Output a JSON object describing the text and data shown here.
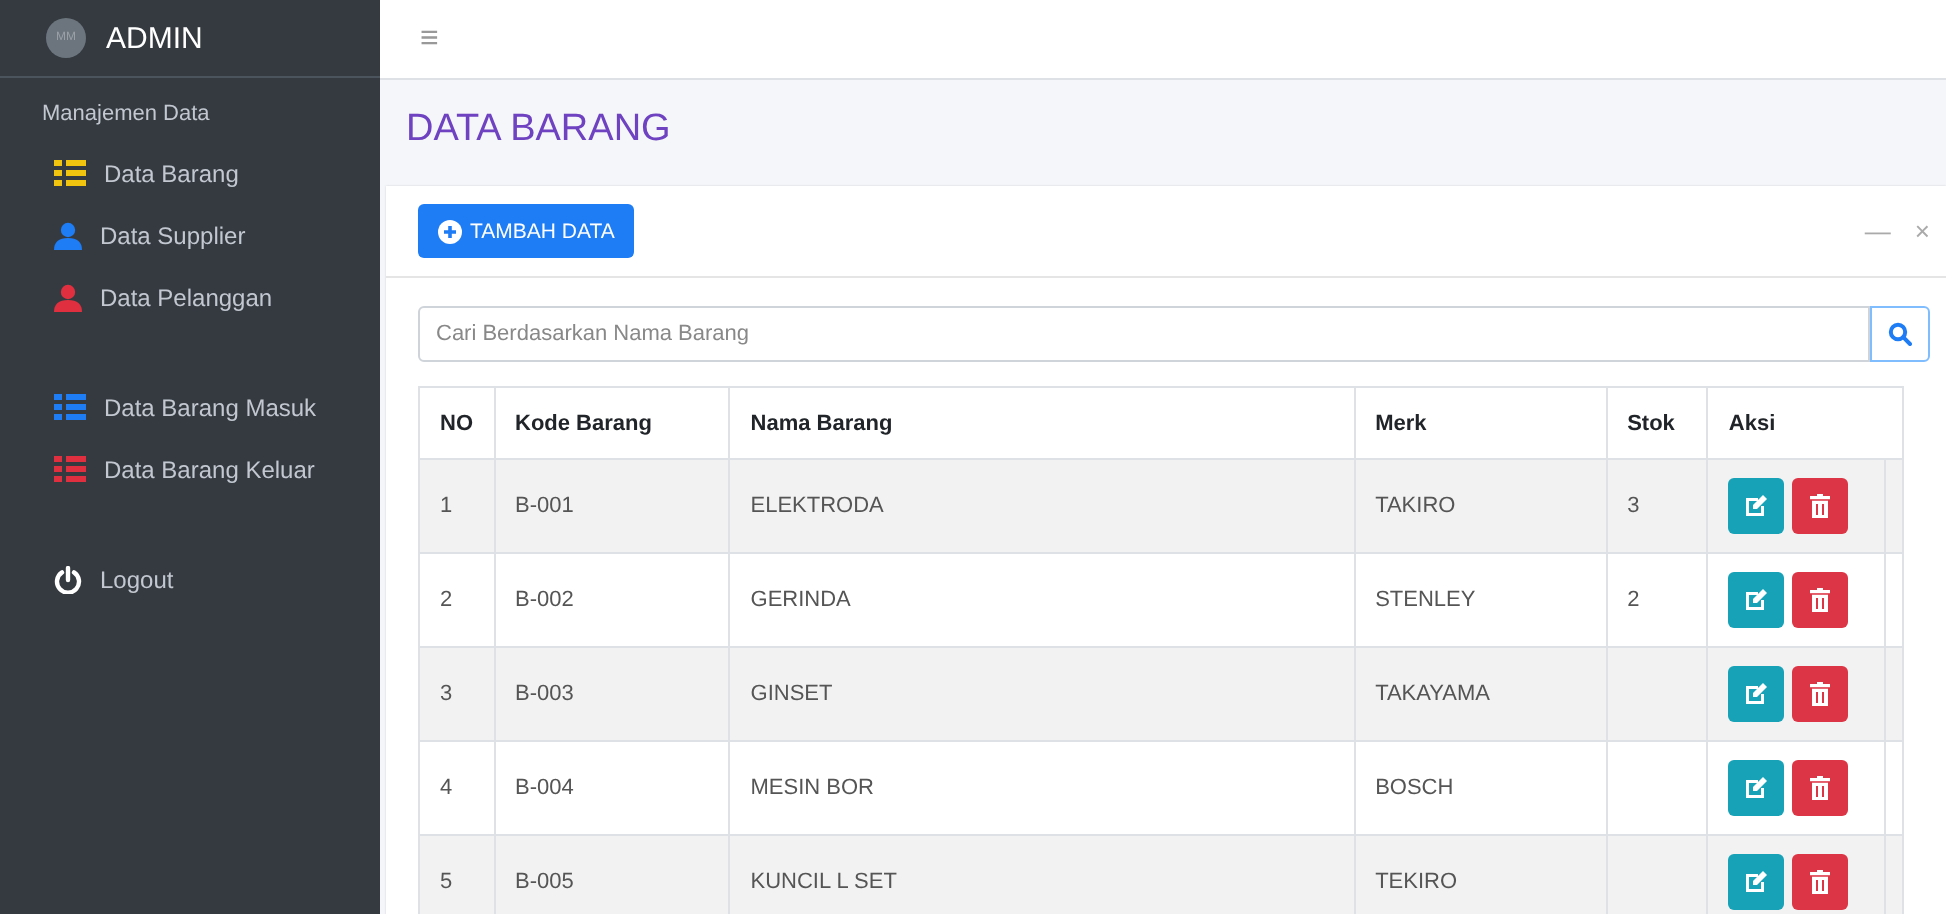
{
  "brand": {
    "avatar": "MM",
    "title": "ADMIN"
  },
  "sidebar": {
    "heading": "Manajemen Data",
    "groups": [
      [
        {
          "label": "Data Barang",
          "kind": "list",
          "color": "#f1c40f"
        },
        {
          "label": "Data Supplier",
          "kind": "user",
          "color": "#1e7cf5"
        },
        {
          "label": "Data Pelanggan",
          "kind": "user",
          "color": "#e0303f"
        }
      ],
      [
        {
          "label": "Data Barang Masuk",
          "kind": "list",
          "color": "#1e7cf5"
        },
        {
          "label": "Data Barang Keluar",
          "kind": "list",
          "color": "#e0303f"
        }
      ],
      [
        {
          "label": "Logout",
          "kind": "power",
          "color": "#ffffff"
        }
      ]
    ]
  },
  "topbar": {
    "menu": "≡"
  },
  "page": {
    "title": "DATA BARANG"
  },
  "card": {
    "add_button": "TAMBAH DATA",
    "minimize": "—",
    "close": "×"
  },
  "search": {
    "placeholder": "Cari Berdasarkan Nama Barang"
  },
  "table": {
    "columns": [
      "NO",
      "Kode Barang",
      "Nama Barang",
      "Merk",
      "Stok",
      "Aksi"
    ],
    "rows": [
      {
        "no": "1",
        "kode": "B-001",
        "nama": "ELEKTRODA",
        "merk": "TAKIRO",
        "stok": "3"
      },
      {
        "no": "2",
        "kode": "B-002",
        "nama": "GERINDA",
        "merk": "STENLEY",
        "stok": "2"
      },
      {
        "no": "3",
        "kode": "B-003",
        "nama": "GINSET",
        "merk": "TAKAYAMA"
      },
      {
        "no": "4",
        "kode": "B-004",
        "nama": "MESIN BOR",
        "merk": "BOSCH"
      },
      {
        "no": "5",
        "kode": "B-005",
        "nama": "KUNCIL L SET",
        "merk": "TEKIRO"
      }
    ]
  }
}
